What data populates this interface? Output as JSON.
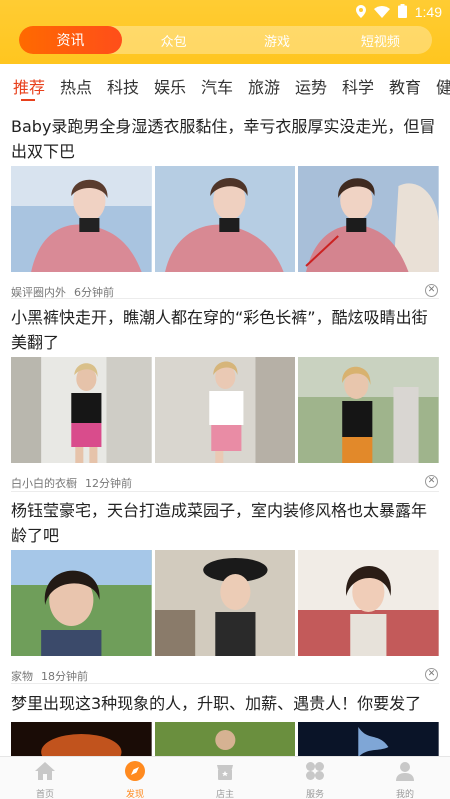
{
  "status_bar": {
    "time": "1:49"
  },
  "top_tabs": [
    {
      "label": "资讯",
      "active": true
    },
    {
      "label": "众包",
      "active": false
    },
    {
      "label": "游戏",
      "active": false
    },
    {
      "label": "短视频",
      "active": false
    }
  ],
  "categories": [
    "推荐",
    "热点",
    "科技",
    "娱乐",
    "汽车",
    "旅游",
    "运势",
    "科学",
    "教育",
    "健"
  ],
  "articles": [
    {
      "title": "Baby录跑男全身湿透衣服黏住，幸亏衣服厚实没走光，但冒出双下巴",
      "source": "娱评圈内外",
      "time": "6分钟前"
    },
    {
      "title": "小黑裤快走开，瞧潮人都在穿的“彩色长裤”，酷炫吸睛出街美翻了",
      "source": "白小白的衣橱",
      "time": "12分钟前"
    },
    {
      "title": "杨钰莹豪宅，天台打造成菜园子，室内装修风格也太暴露年龄了吧",
      "source": "家物",
      "time": "18分钟前"
    },
    {
      "title": "梦里出现这3种现象的人，升职、加薪、遇贵人！你要发了"
    }
  ],
  "bottom_tabs": [
    {
      "label": "首页",
      "icon": "home-icon",
      "active": false
    },
    {
      "label": "发现",
      "icon": "compass-icon",
      "active": true
    },
    {
      "label": "店主",
      "icon": "shop-icon",
      "active": false
    },
    {
      "label": "服务",
      "icon": "service-icon",
      "active": false
    },
    {
      "label": "我的",
      "icon": "user-icon",
      "active": false
    }
  ],
  "colors": {
    "header": "#ffc61f",
    "accent": "#e8401c",
    "active_tab": "#ff8a1f"
  }
}
